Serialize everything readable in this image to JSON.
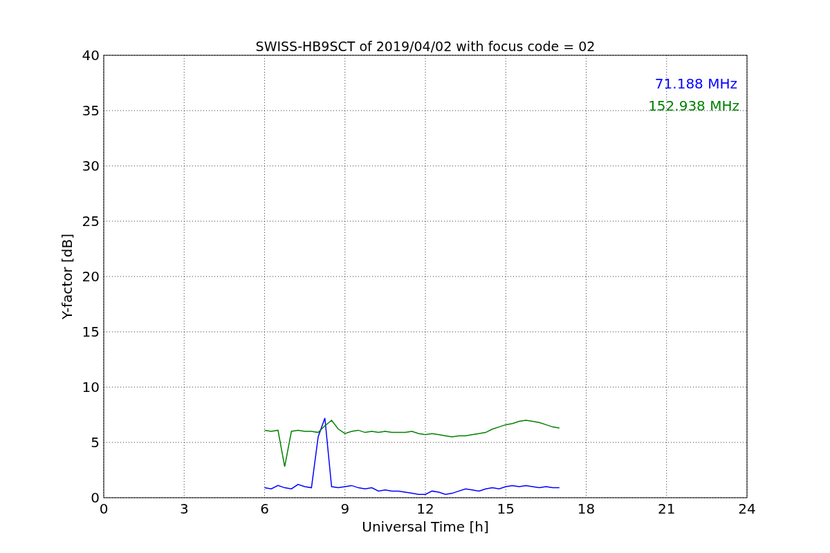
{
  "figure": {
    "chart_data": {
      "type": "line",
      "title": "SWISS-HB9SCT of 2019/04/02 with focus code = 02",
      "xlabel": "Universal Time [h]",
      "ylabel": "Y-factor [dB]",
      "x": [
        6,
        6.25,
        6.5,
        6.75,
        7,
        7.25,
        7.5,
        7.75,
        8,
        8.25,
        8.5,
        8.75,
        9,
        9.25,
        9.5,
        9.75,
        10,
        10.25,
        10.5,
        10.75,
        11,
        11.25,
        11.5,
        11.75,
        12,
        12.25,
        12.5,
        12.75,
        13,
        13.25,
        13.5,
        13.75,
        14,
        14.25,
        14.5,
        14.75,
        15,
        15.25,
        15.5,
        15.75,
        16,
        16.25,
        16.5,
        16.75,
        17
      ],
      "series": [
        {
          "name": "71.188 MHz",
          "color": "#0000ff",
          "values": [
            0.9,
            0.8,
            1.1,
            0.9,
            0.8,
            1.2,
            1.0,
            0.9,
            5.5,
            7.2,
            1.0,
            0.9,
            1.0,
            1.1,
            0.9,
            0.8,
            0.9,
            0.6,
            0.7,
            0.6,
            0.6,
            0.5,
            0.4,
            0.3,
            0.3,
            0.6,
            0.5,
            0.3,
            0.4,
            0.6,
            0.8,
            0.7,
            0.6,
            0.8,
            0.9,
            0.8,
            1.0,
            1.1,
            1.0,
            1.1,
            1.0,
            0.9,
            1.0,
            0.9,
            0.9
          ]
        },
        {
          "name": "152.938 MHz",
          "color": "#008000",
          "values": [
            6.1,
            6.0,
            6.1,
            2.8,
            6.0,
            6.1,
            6.0,
            6.0,
            5.9,
            6.5,
            7.0,
            6.2,
            5.8,
            6.0,
            6.1,
            5.9,
            6.0,
            5.9,
            6.0,
            5.9,
            5.9,
            5.9,
            6.0,
            5.8,
            5.7,
            5.8,
            5.7,
            5.6,
            5.5,
            5.6,
            5.6,
            5.7,
            5.8,
            5.9,
            6.2,
            6.4,
            6.6,
            6.7,
            6.9,
            7.0,
            6.9,
            6.8,
            6.6,
            6.4,
            6.3
          ]
        }
      ],
      "grid": true,
      "xlim": [
        0,
        24
      ],
      "ylim": [
        0,
        40
      ],
      "xticks": [
        0,
        3,
        6,
        9,
        12,
        15,
        18,
        21,
        24
      ],
      "yticks": [
        0,
        5,
        10,
        15,
        20,
        25,
        30,
        35,
        40
      ]
    }
  }
}
